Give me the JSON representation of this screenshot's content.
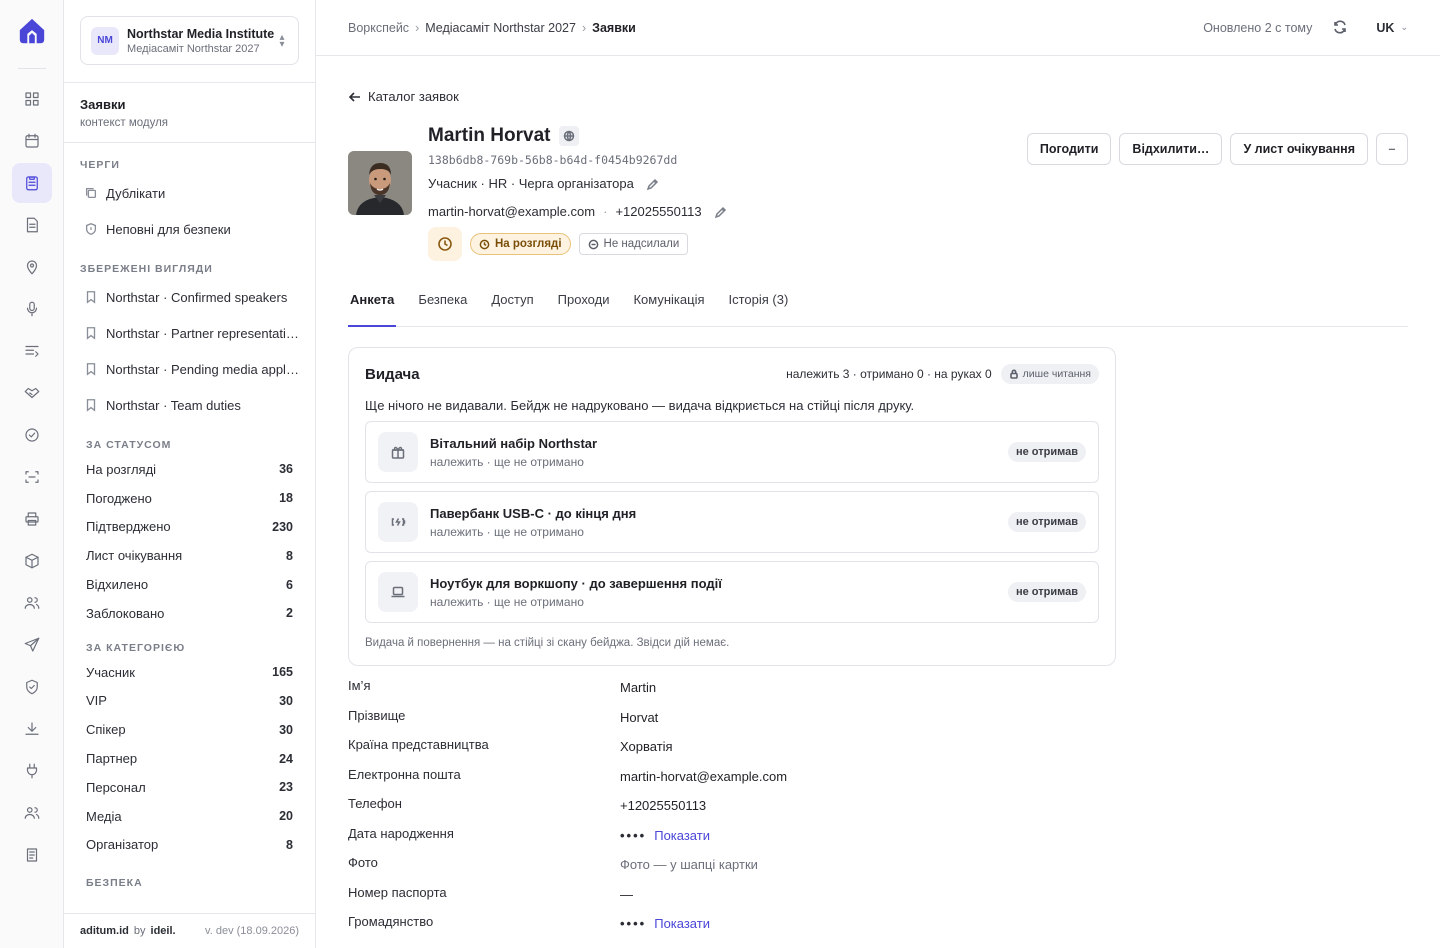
{
  "workspace": {
    "badge": "NM",
    "name": "Northstar Media Institute",
    "sub": "Медіасаміт Northstar 2027"
  },
  "context": {
    "title": "Заявки",
    "subtitle": "контекст модуля"
  },
  "sidebar": {
    "queues_heading": "ЧЕРГИ",
    "queues": [
      {
        "label": "Дублікати",
        "icon": "copy-icon"
      },
      {
        "label": "Неповні для безпеки",
        "icon": "shield-icon"
      }
    ],
    "saved_heading": "ЗБЕРЕЖЕНІ ВИГЛЯДИ",
    "saved": [
      {
        "label": "Northstar · Confirmed speakers"
      },
      {
        "label": "Northstar · Partner representatives"
      },
      {
        "label": "Northstar · Pending media applications"
      },
      {
        "label": "Northstar · Team duties"
      }
    ],
    "status_heading": "ЗА СТАТУСОМ",
    "status": [
      {
        "label": "На розгляді",
        "count": "36"
      },
      {
        "label": "Погоджено",
        "count": "18"
      },
      {
        "label": "Підтверджено",
        "count": "230"
      },
      {
        "label": "Лист очікування",
        "count": "8"
      },
      {
        "label": "Відхилено",
        "count": "6"
      },
      {
        "label": "Заблоковано",
        "count": "2"
      }
    ],
    "category_heading": "ЗА КАТЕГОРІЄЮ",
    "category": [
      {
        "label": "Учасник",
        "count": "165"
      },
      {
        "label": "VIP",
        "count": "30"
      },
      {
        "label": "Спікер",
        "count": "30"
      },
      {
        "label": "Партнер",
        "count": "24"
      },
      {
        "label": "Персонал",
        "count": "23"
      },
      {
        "label": "Медіа",
        "count": "20"
      },
      {
        "label": "Організатор",
        "count": "8"
      }
    ],
    "security_heading": "БЕЗПЕКА",
    "footer": {
      "brand": "aditum.id",
      "by": "by",
      "vendor": "ideil.",
      "version": "v. dev (18.09.2026)"
    }
  },
  "topbar": {
    "crumbs": [
      "Воркспейс",
      "Медіасаміт Northstar 2027",
      "Заявки"
    ],
    "updated": "Оновлено 2 с тому",
    "lang": "UK"
  },
  "page": {
    "back_label": "Каталог заявок",
    "name": "Martin Horvat",
    "uid": "138b6db8-769b-56b8-b64d-f0454b9267dd",
    "role": "Учасник · HR · Черга організатора",
    "email": "martin-horvat@example.com",
    "phone": "+12025550113",
    "status_badge": "На розгляді",
    "notify_badge": "Не надсилали",
    "actions": {
      "approve": "Погодити",
      "reject": "Відхилити…",
      "waitlist": "У лист очікування",
      "more": "–"
    },
    "tabs": [
      "Анкета",
      "Безпека",
      "Доступ",
      "Проходи",
      "Комунікація",
      "Історія (3)"
    ]
  },
  "issue": {
    "title": "Видача",
    "meta": "належить 3 · отримано 0 · на руках 0",
    "readonly": "лише читання",
    "desc": "Ще нічого не видавали. Бейдж не надруковано — видача відкриється на стійці після друку.",
    "items": [
      {
        "name": "Вітальний набір Northstar",
        "sub": "належить · ще не отримано",
        "status": "не отримав",
        "icon": "gift-icon"
      },
      {
        "name": "Павербанк USB-C · до кінця дня",
        "sub": "належить · ще не отримано",
        "status": "не отримав",
        "icon": "battery-icon"
      },
      {
        "name": "Ноутбук для воркшопу · до завершення події",
        "sub": "належить · ще не отримано",
        "status": "не отримав",
        "icon": "laptop-icon"
      }
    ],
    "foot": "Видача й повернення — на стійці зі скану бейджа. Звідси дій немає."
  },
  "fields": [
    {
      "label": "Ім’я",
      "value": "Martin"
    },
    {
      "label": "Прізвище",
      "value": "Horvat"
    },
    {
      "label": "Країна представництва",
      "value": "Хорватія"
    },
    {
      "label": "Електронна пошта",
      "value": "martin-horvat@example.com"
    },
    {
      "label": "Телефон",
      "value": "+12025550113"
    },
    {
      "label": "Дата народження",
      "mask": "••••",
      "show": "Показати"
    },
    {
      "label": "Фото",
      "value": "Фото — у шапці картки",
      "muted": true
    },
    {
      "label": "Номер паспорта",
      "value": "—"
    },
    {
      "label": "Громадянство",
      "mask": "••••",
      "show": "Показати"
    }
  ],
  "colors": {
    "accent": "#4a46d8",
    "review_bg": "#fdf3e0",
    "review_border": "#e8c27a"
  }
}
